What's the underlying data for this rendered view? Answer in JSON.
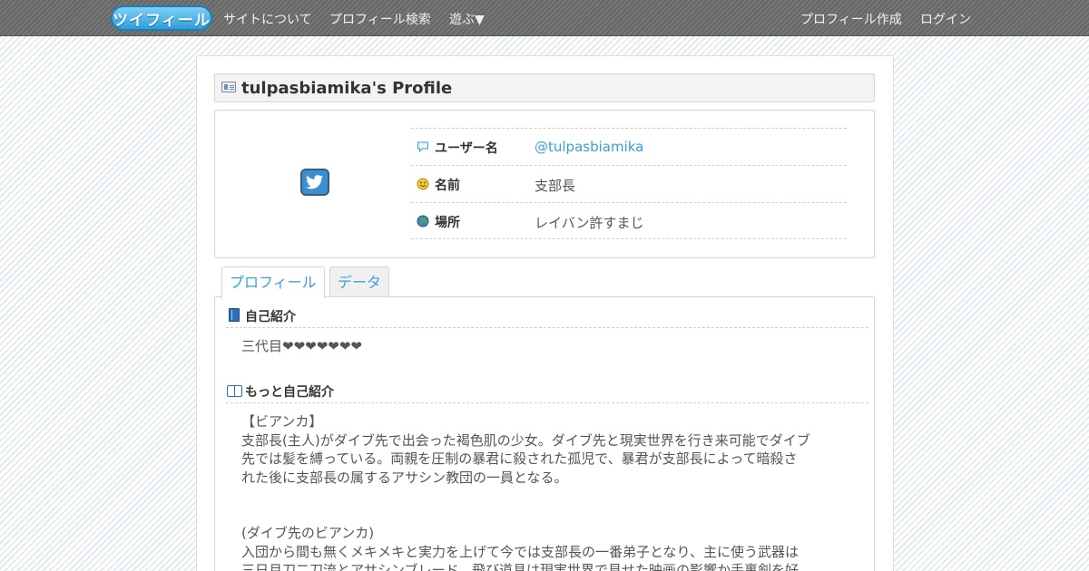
{
  "nav": {
    "logo": "ツイフィール",
    "links": [
      "サイトについて",
      "プロフィール検索",
      "遊ぶ▼"
    ],
    "right_links": [
      "プロフィール作成",
      "ログイン"
    ]
  },
  "page_title": "tulpasbiamika's Profile",
  "profile": {
    "avatar_icon": "twitter-bird-icon",
    "rows": [
      {
        "icon": "speech-bubble-icon",
        "label": "ユーザー名",
        "value": "@tulpasbiamika"
      },
      {
        "icon": "smiley-icon",
        "label": "名前",
        "value": "支部長"
      },
      {
        "icon": "globe-icon",
        "label": "場所",
        "value": "レイバン許すまじ"
      }
    ]
  },
  "tabs": [
    "プロフィール",
    "データ"
  ],
  "sections": [
    {
      "icon": "book-icon",
      "title": "自己紹介",
      "body": "三代目❤❤❤❤❤❤❤"
    },
    {
      "icon": "open-book-icon",
      "title": "もっと自己紹介",
      "body": "【ビアンカ】\n支部長(主人)がダイブ先で出会った褐色肌の少女。ダイブ先と現実世界を行き来可能でダイブ\n先では髪を縛っている。両親を圧制の暴君に殺された孤児で、暴君が支部長によって暗殺さ\nれた後に支部長の属するアサシン教団の一員となる。\n\n\n(ダイブ先のビアンカ)\n入団から間も無くメキメキと実力を上げて今では支部長の一番弟子となり、主に使う武器は\n三日月刀二刀流とアサシンブレード、飛び道具は現実世界で見せた映画の影響か手裏剣を好"
    }
  ],
  "colors": {
    "link": "#3a9fd8",
    "navbar": "#6d6d6d",
    "logo": "#2d9fdc"
  }
}
